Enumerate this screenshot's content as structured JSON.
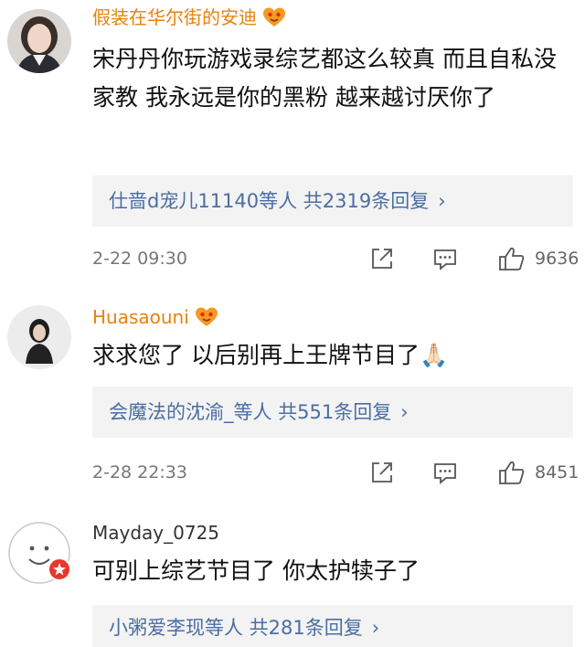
{
  "comments": [
    {
      "username": "假装在华尔街的安迪",
      "text": "宋丹丹你玩游戏录综艺都这么较真 而且自私没家教 我永远是你的黑粉 越来越讨厌你了",
      "replies_label": "仕啬d宠儿11140等人 共2319条回复",
      "time": "2-22 09:30",
      "likes": "9636"
    },
    {
      "username": "Huasaouni",
      "text": "求求您了 以后别再上王牌节目了🙏🏻",
      "replies_label": "会魔法的沈渝_等人 共551条回复",
      "time": "2-28 22:33",
      "likes": "8451"
    },
    {
      "username": "Mayday_0725",
      "text": "可别上综艺节目了 你太护犊子了",
      "replies_label": "小粥爱李现等人 共281条回复"
    }
  ],
  "ui": {
    "chevron": "›"
  },
  "icons": {
    "share": "share-icon",
    "comment": "comment-icon",
    "like": "thumbs-up-icon",
    "vip": "vip-heart-badge-icon",
    "weibo": "weibo-badge-icon"
  },
  "colors": {
    "vip_name": "#e8820c",
    "link_blue": "#4a6ea3",
    "reply_bg": "#f3f3f3",
    "meta_gray": "#777777"
  }
}
